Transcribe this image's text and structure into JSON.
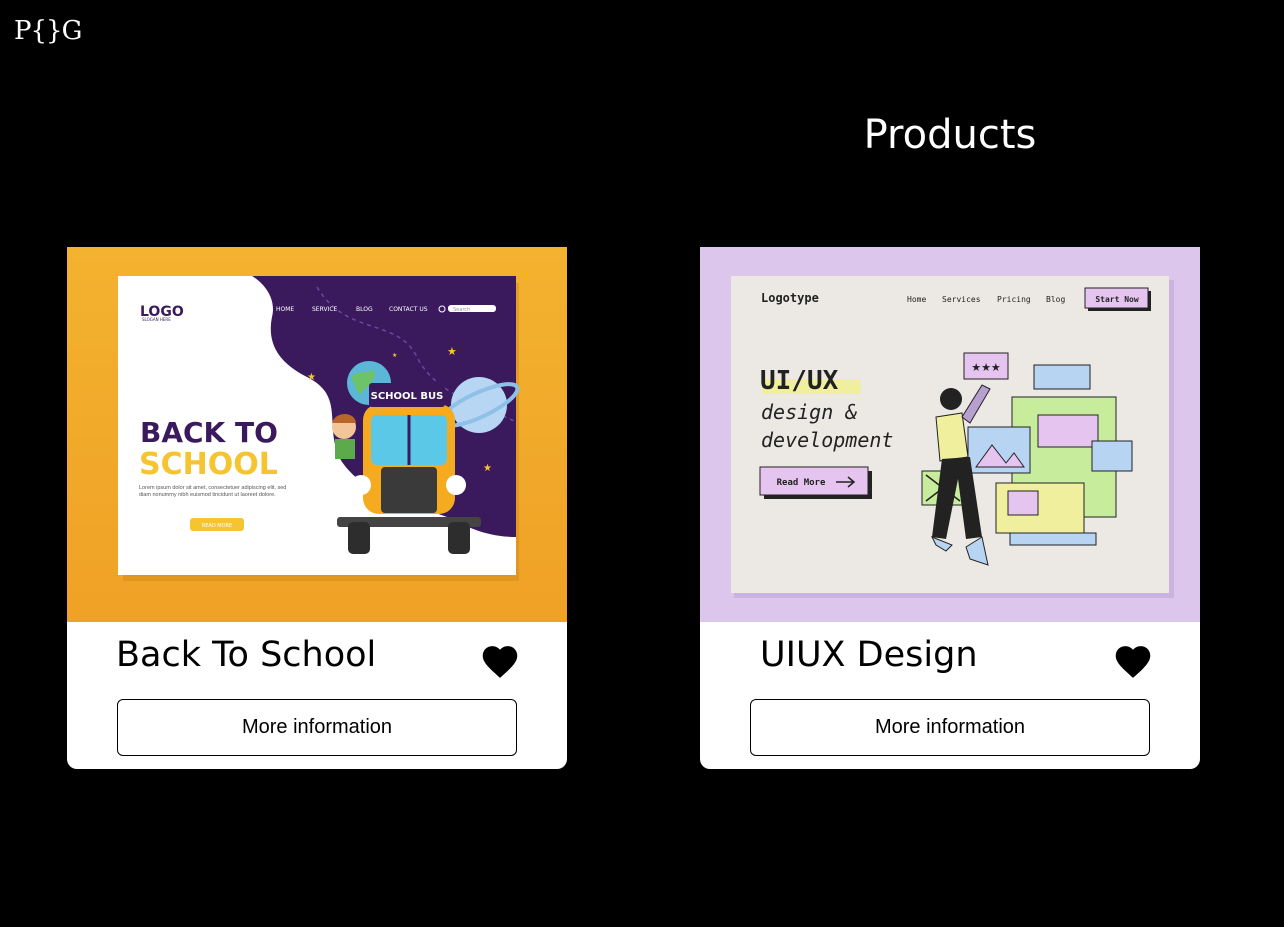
{
  "brand": {
    "logo_text": "P{}G"
  },
  "page": {
    "title": "Products"
  },
  "products": [
    {
      "name": "Back To School",
      "button_label": "More information",
      "image": {
        "logo": "LOGO",
        "slogan": "SLOGAN HERE",
        "nav": [
          "HOME",
          "SERVICE",
          "BLOG",
          "CONTACT US"
        ],
        "search_placeholder": "Search",
        "headline_1": "BACK TO",
        "headline_2": "SCHOOL",
        "body": "Lorem ipsum dolor sit amet, consectetuer adipiscing elit, sed diam nonummy nibh euismod tincidunt ut laoreet dolore.",
        "cta": "READ MORE",
        "bus_sign": "SCHOOL BUS"
      },
      "colors": {
        "bg": "#f2a629",
        "purple": "#3a1a5c",
        "yellow": "#f5c531"
      }
    },
    {
      "name": "UIUX Design",
      "button_label": "More information",
      "image": {
        "logo": "Logotype",
        "nav": [
          "Home",
          "Services",
          "Pricing",
          "Blog"
        ],
        "cta_top": "Start Now",
        "headline": "UI/UX",
        "line_2": "design &",
        "line_3": "development",
        "cta": "Read More"
      },
      "colors": {
        "bg": "#dcc6ec",
        "panel": "#ece8e4",
        "accent": "#e5c4f0"
      }
    }
  ]
}
